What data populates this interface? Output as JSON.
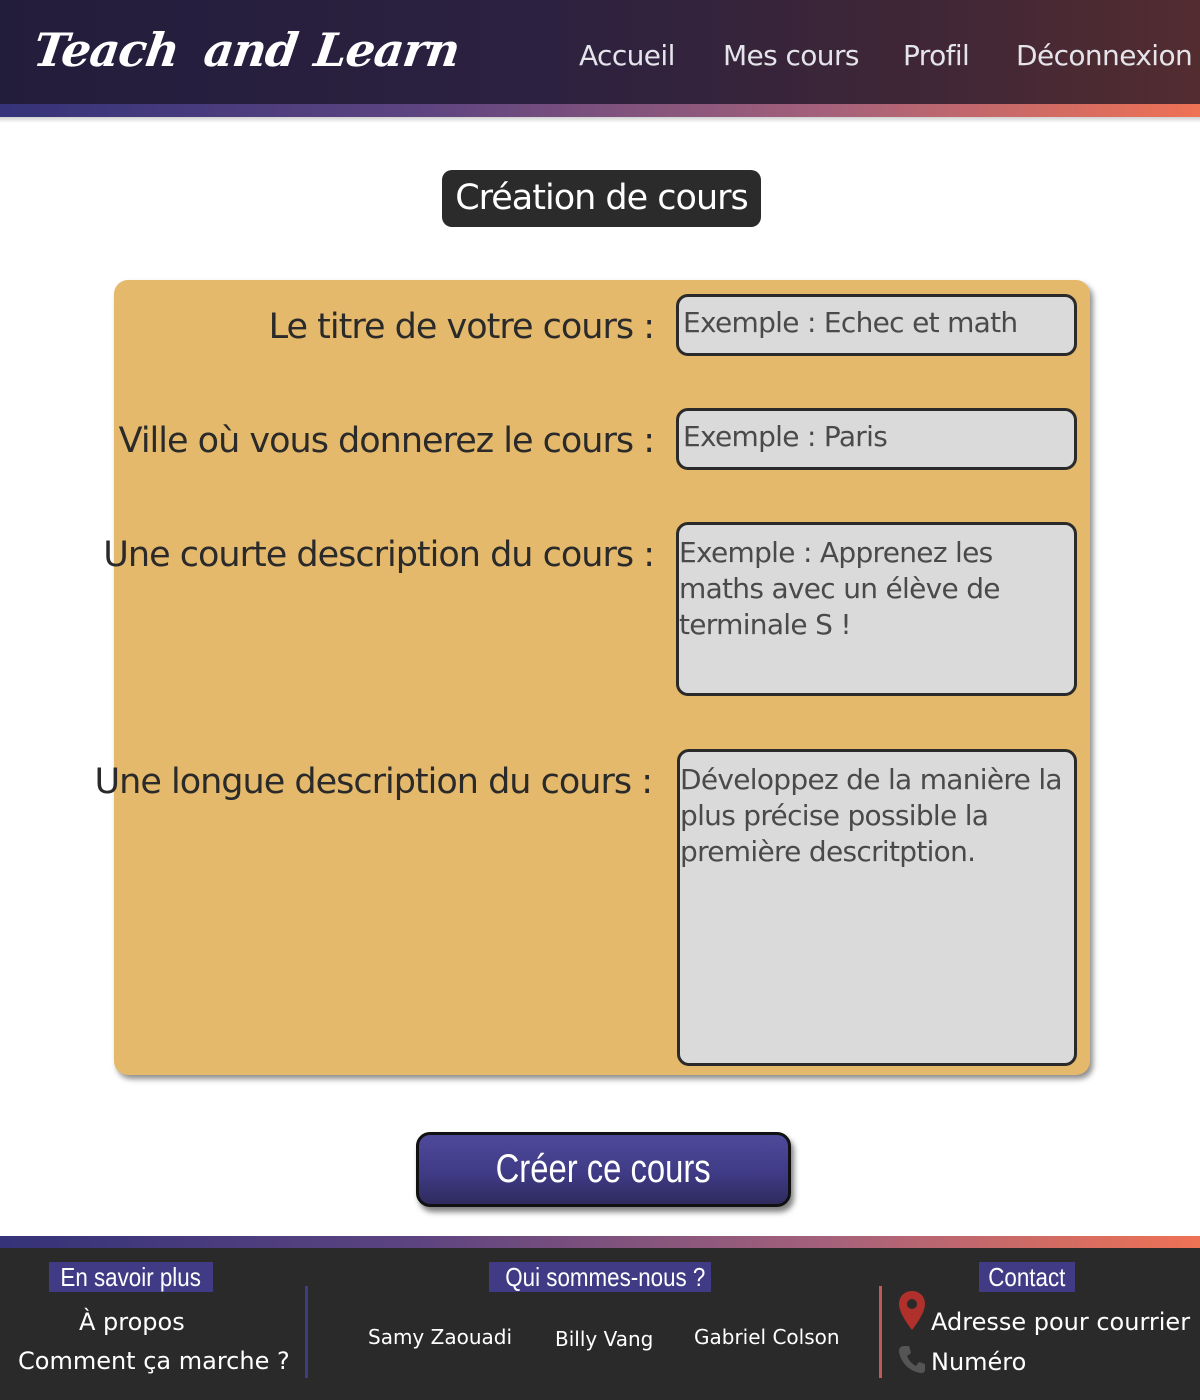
{
  "header": {
    "logo": [
      "Teach",
      "and",
      "Learn"
    ],
    "nav": [
      "Accueil",
      "Mes cours",
      "Profil",
      "Déconnexion"
    ]
  },
  "page_title": "Création de cours",
  "form": {
    "title_label": "Le titre de votre cours :",
    "title_placeholder": "Exemple  : Echec et math",
    "city_label": "Ville où vous donnerez le cours :",
    "city_placeholder": "Exemple  : Paris",
    "short_desc_label": "Une courte description du cours :",
    "short_desc_placeholder": " Exemple  : Apprenez les maths avec un élève de terminale S !",
    "long_desc_label": "Une longue description du cours :",
    "long_desc_placeholder": " Développez de la manière la plus précise possible la première descritption.",
    "submit_label": "Créer ce cours"
  },
  "footer": {
    "learn_more": {
      "heading": "En savoir plus",
      "links": [
        "À propos",
        "Comment ça marche ?"
      ]
    },
    "about_us": {
      "heading": "Qui sommes-nous ?",
      "names": [
        "Samy Zaouadi",
        "Billy Vang",
        "Gabriel Colson"
      ]
    },
    "contact": {
      "heading": "Contact",
      "address": "Adresse pour courrier",
      "phone": "Numéro",
      "icons": [
        "map-pin-icon",
        "phone-icon"
      ]
    }
  },
  "colors": {
    "header_bg": "#2a2040",
    "gradient_start": "#35337a",
    "gradient_end": "#ef7254",
    "panel": "#e4b96c",
    "field": "#dadada",
    "button": "#403b86",
    "footer_bg": "#2a2a2a",
    "pin": "#b0302c"
  }
}
